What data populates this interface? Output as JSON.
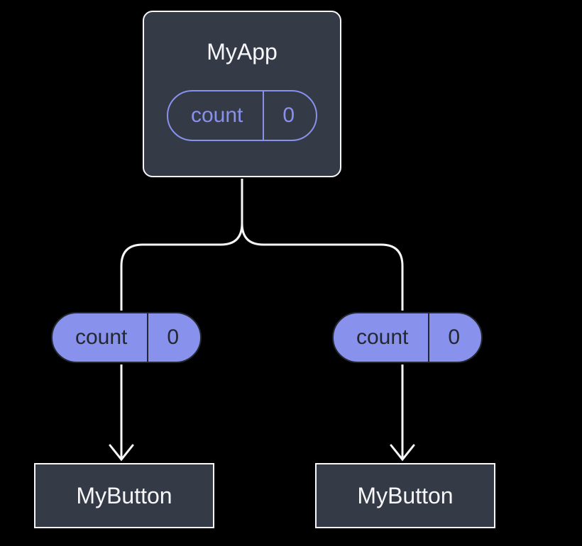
{
  "parent": {
    "title": "MyApp",
    "state": {
      "label": "count",
      "value": "0"
    }
  },
  "props": {
    "left": {
      "label": "count",
      "value": "0"
    },
    "right": {
      "label": "count",
      "value": "0"
    }
  },
  "children": {
    "left": {
      "title": "MyButton"
    },
    "right": {
      "title": "MyButton"
    }
  }
}
